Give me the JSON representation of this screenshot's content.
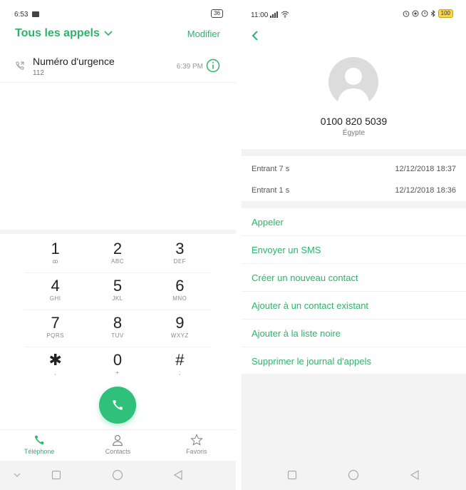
{
  "left": {
    "status": {
      "time": "6:53",
      "battery": "36"
    },
    "header": {
      "title": "Tous les appels",
      "edit": "Modifier"
    },
    "calls": [
      {
        "name": "Numéro d'urgence",
        "number": "112",
        "time": "6:39 PM"
      }
    ],
    "keypad": [
      [
        {
          "digit": "1",
          "letters": "ꝏ"
        },
        {
          "digit": "2",
          "letters": "ABC"
        },
        {
          "digit": "3",
          "letters": "DEF"
        }
      ],
      [
        {
          "digit": "4",
          "letters": "GHI"
        },
        {
          "digit": "5",
          "letters": "JKL"
        },
        {
          "digit": "6",
          "letters": "MNO"
        }
      ],
      [
        {
          "digit": "7",
          "letters": "PQRS"
        },
        {
          "digit": "8",
          "letters": "TUV"
        },
        {
          "digit": "9",
          "letters": "WXYZ"
        }
      ],
      [
        {
          "digit": "✱",
          "letters": ","
        },
        {
          "digit": "0",
          "letters": "+"
        },
        {
          "digit": "#",
          "letters": ";"
        }
      ]
    ],
    "tabs": {
      "phone": "Téléphone",
      "contacts": "Contacts",
      "favorites": "Favoris"
    },
    "accent": "#2fb36a"
  },
  "right": {
    "status": {
      "time": "11:00",
      "battery": "100"
    },
    "contact": {
      "number": "0100 820 5039",
      "country": "Égypte"
    },
    "history": [
      {
        "type": "Entrant  7 s",
        "date": "12/12/2018 18:37"
      },
      {
        "type": "Entrant  1 s",
        "date": "12/12/2018 18:36"
      }
    ],
    "actions": {
      "call": "Appeler",
      "sms": "Envoyer un SMS",
      "new_contact": "Créer un nouveau contact",
      "add_existing": "Ajouter à un contact existant",
      "blacklist": "Ajouter à la liste noire",
      "delete_log": "Supprimer le journal d'appels"
    }
  }
}
